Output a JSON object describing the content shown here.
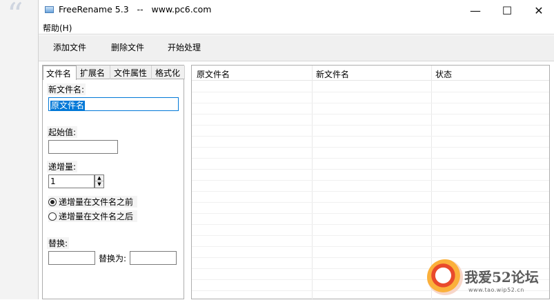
{
  "window": {
    "title": "FreeRename 5.3   --   www.pc6.com",
    "controls": {
      "minimize": "—",
      "maximize": "☐",
      "close": "✕"
    }
  },
  "menu": {
    "help": "帮助(H)"
  },
  "toolbar": {
    "add": "添加文件",
    "remove": "删除文件",
    "start": "开始处理"
  },
  "tabs": [
    {
      "label": "文件名",
      "active": true
    },
    {
      "label": "扩展名",
      "active": false
    },
    {
      "label": "文件属性",
      "active": false
    },
    {
      "label": "格式化",
      "active": false
    }
  ],
  "form": {
    "new_name_label": "新文件名:",
    "new_name_value": "原文件名",
    "start_label": "起始值:",
    "start_value": "",
    "increment_label": "递增量:",
    "increment_value": "1",
    "radio_before": "递增量在文件名之前",
    "radio_after": "递增量在文件名之后",
    "replace_label": "替换:",
    "replace_value": "",
    "replace_with_label": "替换为:",
    "replace_with_value": ""
  },
  "grid": {
    "columns": [
      "原文件名",
      "新文件名",
      "状态"
    ]
  },
  "watermark": {
    "text": "我爱52论坛",
    "url": "www.tao.wip52.cn"
  },
  "colors": {
    "selection": "#0078d7",
    "toolbar_bg": "#f0f0f0"
  }
}
